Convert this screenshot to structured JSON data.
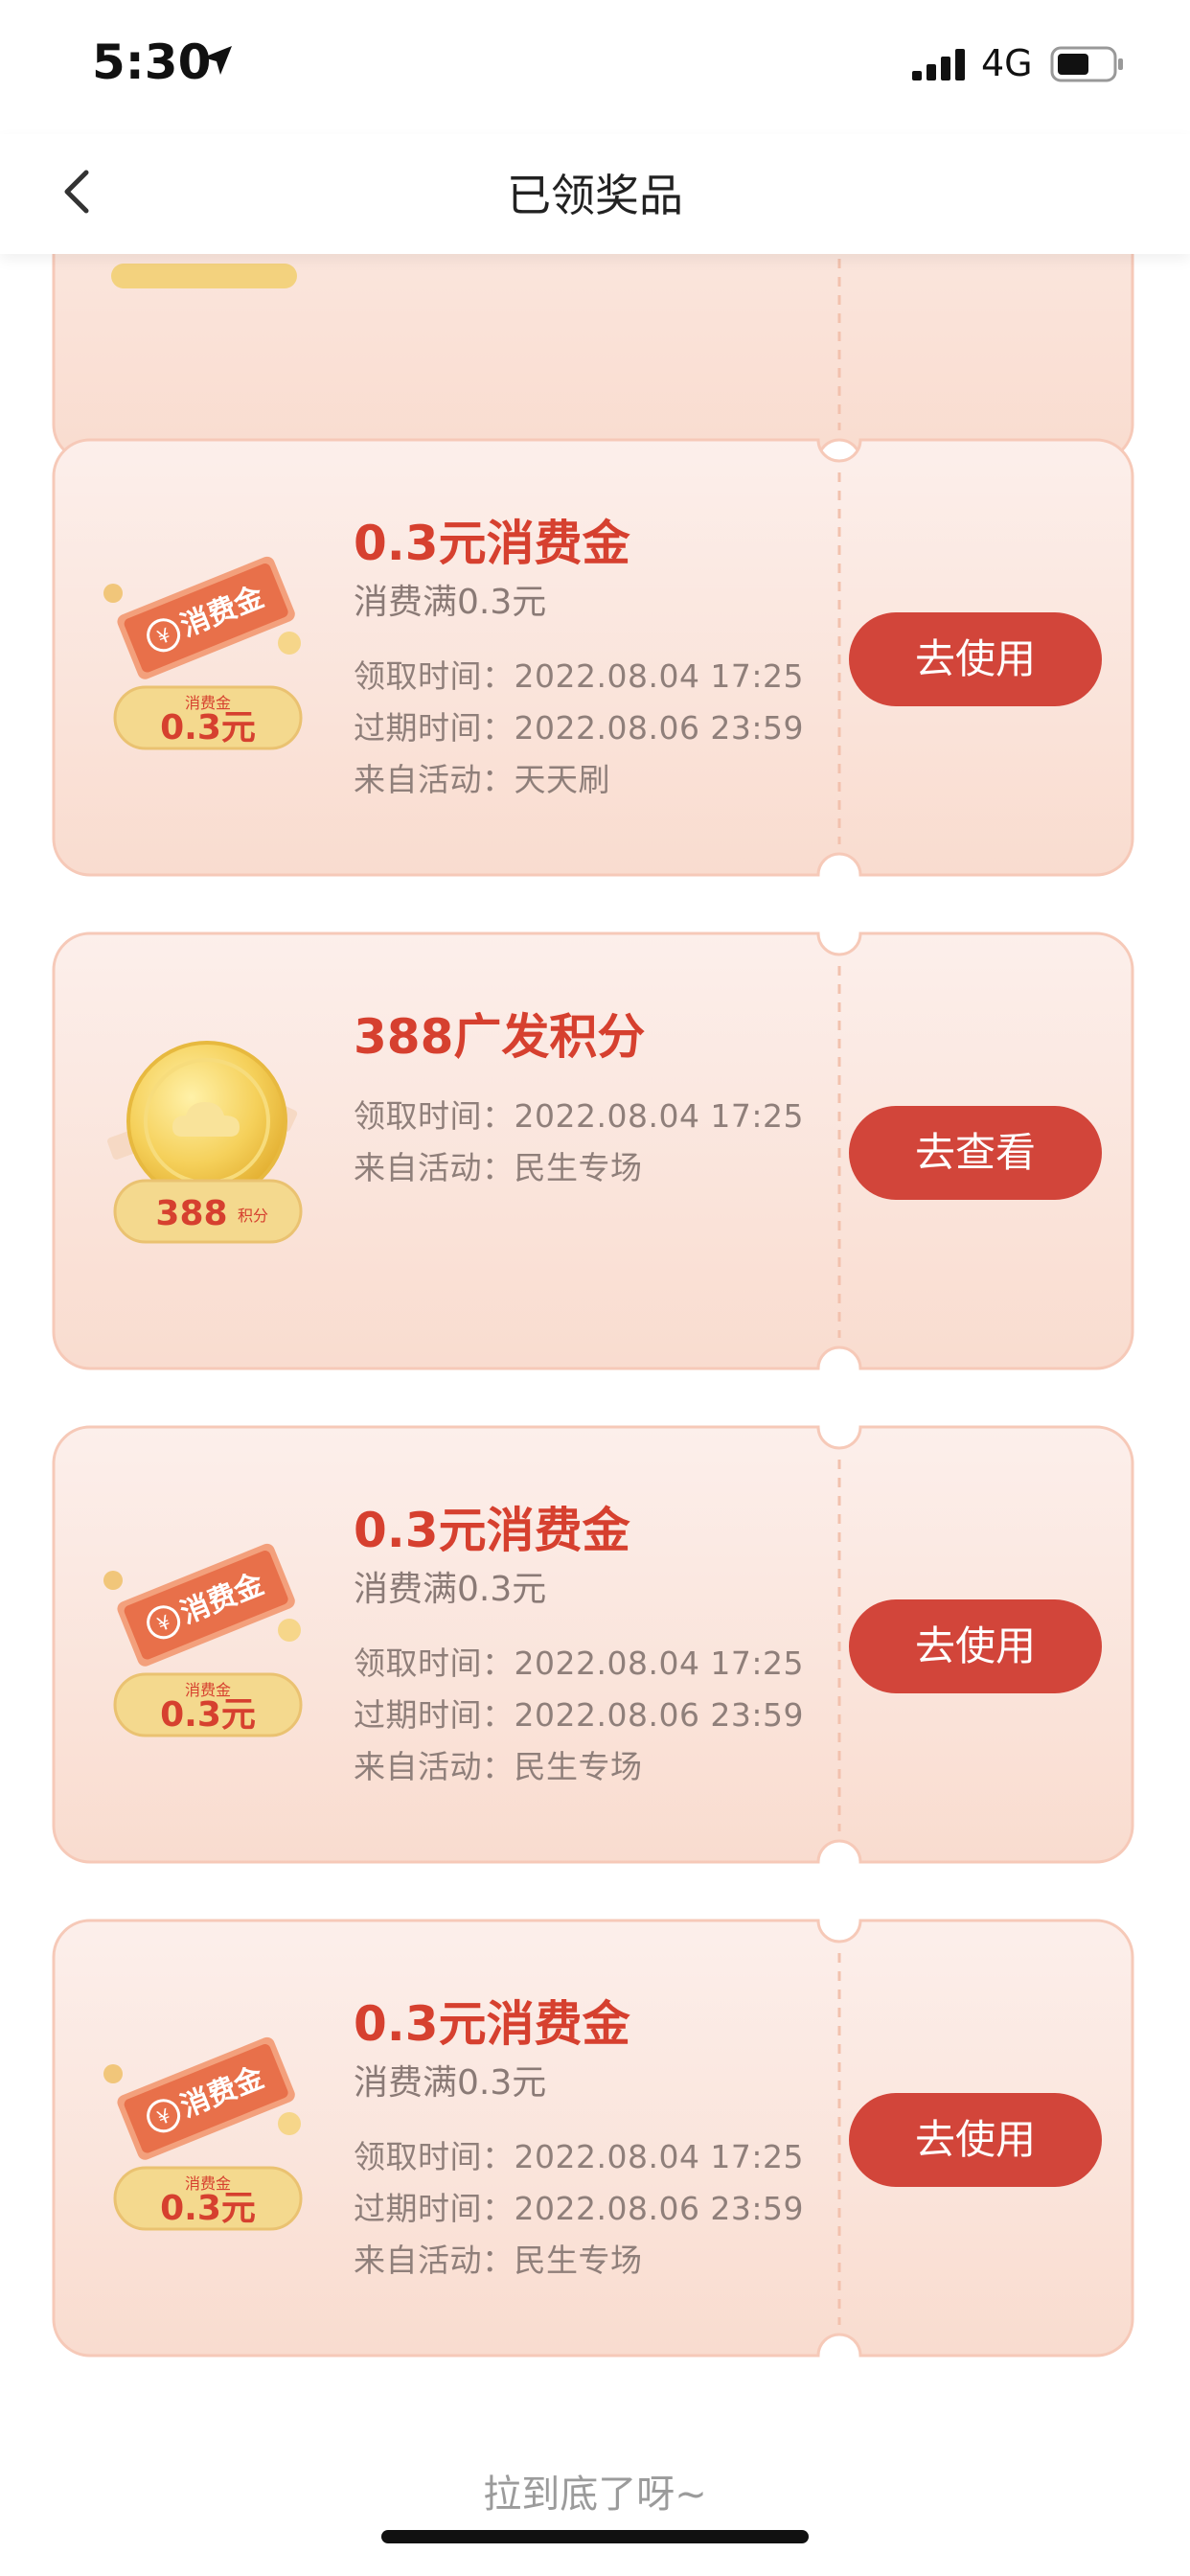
{
  "status_bar": {
    "time": "5:30",
    "network": "4G"
  },
  "nav": {
    "title": "已领奖品"
  },
  "coupons": [
    {
      "title": "0.3元消费金",
      "subtitle": "消费满0.3元",
      "lines": [
        "领取时间：2022.08.04 17:25",
        "过期时间：2022.08.06 23:59",
        "来自活动：天天刷"
      ],
      "button": "去使用",
      "icon_text": "消费金",
      "icon_badge_small": "消费金",
      "icon_badge": "0.3元"
    },
    {
      "title": "388广发积分",
      "lines": [
        "领取时间：2022.08.04 17:25",
        "来自活动：民生专场"
      ],
      "button": "去查看",
      "icon_badge": "388",
      "icon_badge_small": "积分"
    },
    {
      "title": "0.3元消费金",
      "subtitle": "消费满0.3元",
      "lines": [
        "领取时间：2022.08.04 17:25",
        "过期时间：2022.08.06 23:59",
        "来自活动：民生专场"
      ],
      "button": "去使用",
      "icon_text": "消费金",
      "icon_badge_small": "消费金",
      "icon_badge": "0.3元"
    },
    {
      "title": "0.3元消费金",
      "subtitle": "消费满0.3元",
      "lines": [
        "领取时间：2022.08.04 17:25",
        "过期时间：2022.08.06 23:59",
        "来自活动：民生专场"
      ],
      "button": "去使用",
      "icon_text": "消费金",
      "icon_badge_small": "消费金",
      "icon_badge": "0.3元"
    }
  ],
  "footer": {
    "end_text": "拉到底了呀~"
  },
  "colors": {
    "accent": "#d2453a",
    "title_red": "#d6402f",
    "card_bg": "#fbe6df",
    "card_border": "#f6c9b8"
  },
  "icons": [
    "location-arrow-icon",
    "signal-icon",
    "battery-icon",
    "back-chevron-icon",
    "voucher-icon",
    "coin-icon"
  ]
}
